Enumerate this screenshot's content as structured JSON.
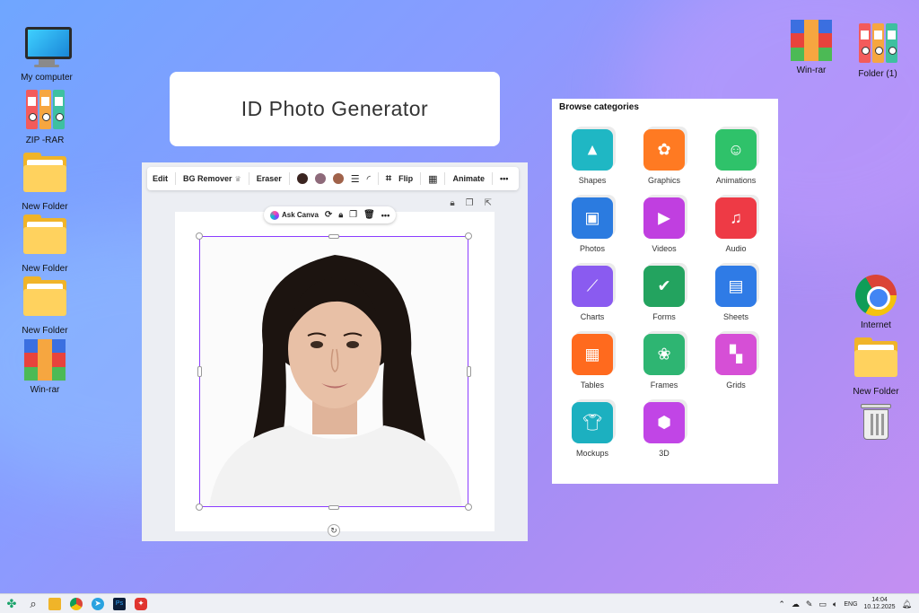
{
  "desktop": {
    "icons": [
      {
        "label": "My computer"
      },
      {
        "label": "ZIP -RAR"
      },
      {
        "label": "New Folder"
      },
      {
        "label": "New Folder"
      },
      {
        "label": "New Folder"
      },
      {
        "label": "Win-rar"
      },
      {
        "label": "Win-rar"
      },
      {
        "label": "Folder (1)"
      },
      {
        "label": "Internet"
      },
      {
        "label": "New Folder"
      }
    ]
  },
  "title_card": {
    "text": "ID Photo Generator"
  },
  "toolbar": {
    "edit": "Edit",
    "bg_remover": "BG Remover",
    "eraser": "Eraser",
    "flip": "Flip",
    "animate": "Animate",
    "more": "•••",
    "swatches": [
      "#3a2420",
      "#8e6a7a",
      "#a0624a"
    ]
  },
  "ask_bar": {
    "label": "Ask Canva"
  },
  "categories": {
    "title": "Browse categories",
    "items": [
      {
        "label": "Shapes",
        "color": "#1fb7c4"
      },
      {
        "label": "Graphics",
        "color": "#ff7a22"
      },
      {
        "label": "Animations",
        "color": "#2fc26a"
      },
      {
        "label": "Photos",
        "color": "#2b7be0"
      },
      {
        "label": "Videos",
        "color": "#c03fe0"
      },
      {
        "label": "Audio",
        "color": "#ee3a45"
      },
      {
        "label": "Charts",
        "color": "#8a5bf0"
      },
      {
        "label": "Forms",
        "color": "#23a35f"
      },
      {
        "label": "Sheets",
        "color": "#2f7be6"
      },
      {
        "label": "Tables",
        "color": "#ff6a1e"
      },
      {
        "label": "Frames",
        "color": "#2eb572"
      },
      {
        "label": "Grids",
        "color": "#d64fd6"
      },
      {
        "label": "Mockups",
        "color": "#1cb0c0"
      },
      {
        "label": "3D",
        "color": "#c145e6"
      }
    ]
  },
  "taskbar": {
    "lang": "ENG",
    "time": "14:04",
    "date": "10.12.2025"
  }
}
